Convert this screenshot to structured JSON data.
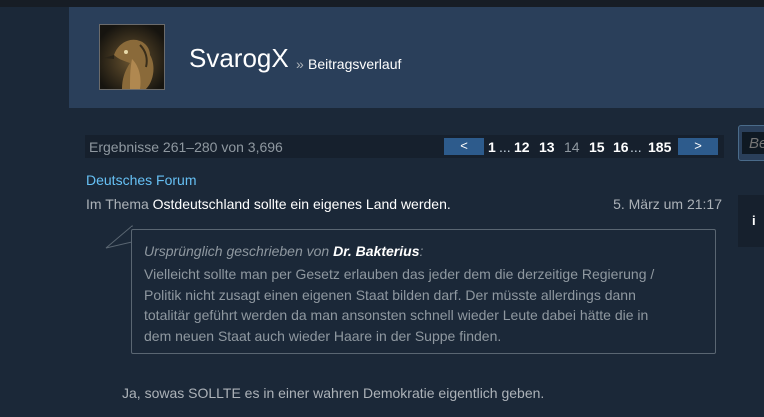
{
  "profile": {
    "user_name": "SvarogX",
    "breadcrumb_separator": "»",
    "section_title": "Beitragsverlauf"
  },
  "paging": {
    "results_text": "Ergebnisse 261–280 von 3,696",
    "prev_label": "<",
    "next_label": ">",
    "pages": [
      "1",
      "...",
      "12",
      "13",
      "14",
      "15",
      "16",
      "...",
      "185"
    ],
    "current_page": "14"
  },
  "search": {
    "placeholder": "Be"
  },
  "side_panel": {
    "label": "i"
  },
  "post": {
    "forum_name": "Deutsches Forum",
    "thread_prefix": "Im Thema",
    "thread_title": "Ostdeutschland sollte ein eigenes Land werden.",
    "date": "5. März um 21:17",
    "quote": {
      "header_prefix": "Ursprünglich geschrieben von",
      "author": "Dr. Bakterius",
      "header_suffix": ":",
      "lines": [
        "Vielleicht sollte man per Gesetz erlauben das jeder dem die derzeitige Regierung /",
        "Politik nicht zusagt einen eigenen Staat bilden darf. Der müsste allerdings dann",
        "totalitär geführt werden da man ansonsten schnell wieder Leute dabei hätte die in",
        "dem neuen Staat auch wieder Haare in der Suppe finden."
      ]
    },
    "reply_text": "Ja, sowas SOLLTE es in einer wahren Demokratie eigentlich geben."
  },
  "colors": {
    "background": "#1b2838",
    "header_bg": "#2a3f5a",
    "link": "#66c0f4",
    "pager_button": "#2d5b8c"
  },
  "icons": {
    "avatar": "raven-avatar-image",
    "info": "info-icon"
  }
}
